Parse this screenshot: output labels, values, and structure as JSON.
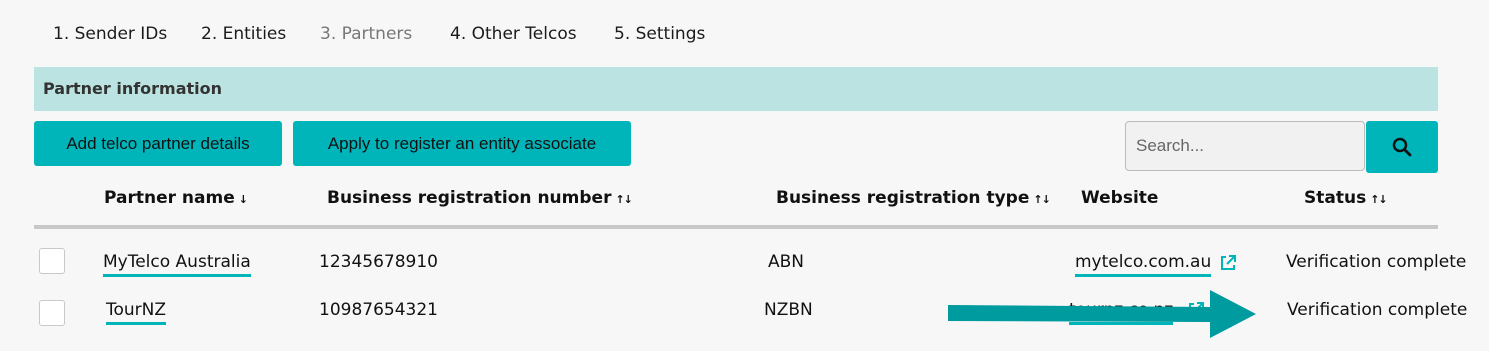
{
  "tabs": [
    {
      "label": "1. Sender IDs",
      "state": "normal"
    },
    {
      "label": "2. Entities",
      "state": "normal"
    },
    {
      "label": "3. Partners",
      "state": "current"
    },
    {
      "label": "4. Other Telcos",
      "state": "normal"
    },
    {
      "label": "5. Settings",
      "state": "normal"
    }
  ],
  "section": {
    "title": "Partner information"
  },
  "toolbar": {
    "add_partner_label": "Add telco partner details",
    "apply_entity_label": "Apply to register an entity associate",
    "search_placeholder": "Search...",
    "search_icon": "search-icon"
  },
  "table": {
    "columns": {
      "partner_name": "Partner name",
      "brn": "Business registration number",
      "brt": "Business registration type",
      "website": "Website",
      "status": "Status"
    },
    "sort_indicators": {
      "sorted_desc": "↓",
      "sortable": "↑↓"
    },
    "rows": [
      {
        "partner_name": "MyTelco Australia",
        "brn": "12345678910",
        "brt": "ABN",
        "website": "mytelco.com.au",
        "status": "Verification complete"
      },
      {
        "partner_name": "TourNZ",
        "brn": "10987654321",
        "brt": "NZBN",
        "website": "tournz.co.nz",
        "status": "Verification complete"
      }
    ]
  },
  "annotation": {
    "icon": "arrow-right-icon",
    "color": "#009b9e"
  },
  "colors": {
    "accent": "#00b5ba",
    "header_bg": "#bbe3e1",
    "page_bg": "#f7f7f7"
  }
}
